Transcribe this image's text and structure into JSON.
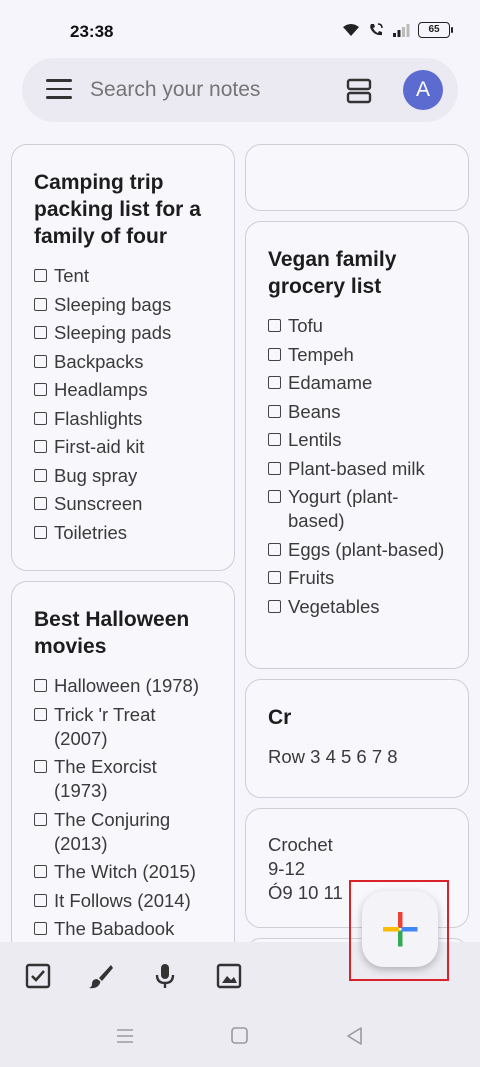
{
  "status_bar": {
    "time": "23:38",
    "battery": "65",
    "icons": [
      "wifi-icon",
      "wifi-call-icon",
      "signal-icon",
      "battery-icon"
    ]
  },
  "search": {
    "placeholder": "Search your notes",
    "avatar_letter": "A"
  },
  "notes": {
    "camping": {
      "title": "Camping trip packing list for a family of four",
      "items": [
        "Tent",
        "Sleeping bags",
        "Sleeping pads",
        "Backpacks",
        "Headlamps",
        "Flashlights",
        "First-aid kit",
        "Bug spray",
        "Sunscreen",
        "Toiletries"
      ]
    },
    "halloween": {
      "title": "Best Halloween movies",
      "items": [
        "Halloween (1978)",
        "Trick 'r Treat (2007)",
        "The Exorcist (1973)",
        "The Conjuring (2013)",
        "The Witch (2015)",
        "It Follows (2014)",
        "The Babadook"
      ]
    },
    "vegan": {
      "title": "Vegan family grocery list",
      "items": [
        "Tofu",
        "Tempeh",
        "Edamame",
        "Beans",
        "Lentils",
        "Plant-based milk",
        "Yogurt (plant-based)",
        "Eggs (plant-based)",
        "Fruits",
        "Vegetables"
      ]
    },
    "cr": {
      "title": "Cr",
      "body": "Row 3 4 5 6 7 8"
    },
    "crochet": {
      "lines": [
        "Crochet",
        "9-12",
        "Ó9 10 11"
      ]
    }
  },
  "toolbar": {
    "items": [
      "checkbox-icon",
      "brush-icon",
      "microphone-icon",
      "image-icon"
    ]
  },
  "colors": {
    "background": "#f6f5fb",
    "avatar": "#5b6bd0",
    "highlight": "#d9232b",
    "plus_blue": "#4285f4",
    "plus_red": "#ea4335",
    "plus_yellow": "#fbbc05",
    "plus_green": "#34a853"
  }
}
